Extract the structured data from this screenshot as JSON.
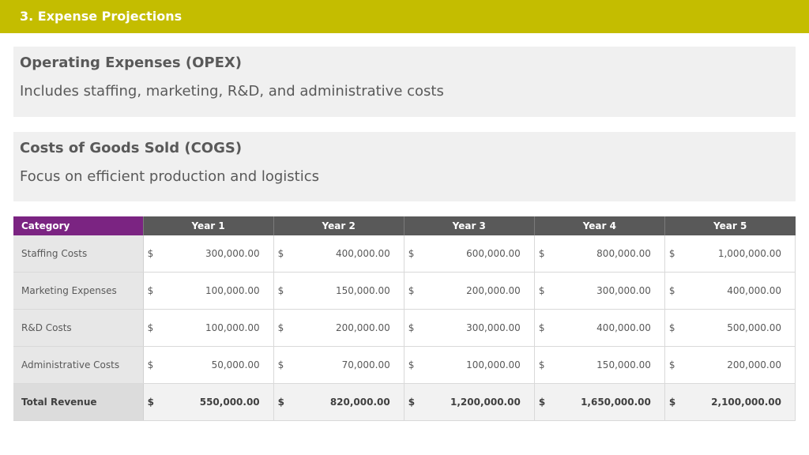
{
  "header": {
    "title": "3. Expense Projections"
  },
  "cards": [
    {
      "title": "Operating Expenses (OPEX)",
      "text": "Includes staffing, marketing, R&D, and administrative costs"
    },
    {
      "title": "Costs of Goods Sold (COGS)",
      "text": "Focus on efficient production and logistics"
    }
  ],
  "table": {
    "category_header": "Category",
    "year_headers": [
      "Year 1",
      "Year 2",
      "Year 3",
      "Year 4",
      "Year 5"
    ],
    "currency_symbol": "$",
    "rows": [
      {
        "label": "Staffing Costs",
        "values": [
          "300,000.00",
          "400,000.00",
          "600,000.00",
          "800,000.00",
          "1,000,000.00"
        ]
      },
      {
        "label": "Marketing Expenses",
        "values": [
          "100,000.00",
          "150,000.00",
          "200,000.00",
          "300,000.00",
          "400,000.00"
        ]
      },
      {
        "label": "R&D Costs",
        "values": [
          "100,000.00",
          "200,000.00",
          "300,000.00",
          "400,000.00",
          "500,000.00"
        ]
      },
      {
        "label": "Administrative Costs",
        "values": [
          "50,000.00",
          "70,000.00",
          "100,000.00",
          "150,000.00",
          "200,000.00"
        ]
      },
      {
        "label": "Total Revenue",
        "values": [
          "550,000.00",
          "820,000.00",
          "1,200,000.00",
          "1,650,000.00",
          "2,100,000.00"
        ]
      }
    ]
  },
  "colors": {
    "header_bar": "#c4bd00",
    "category_header": "#7b2482",
    "year_header": "#595959"
  }
}
